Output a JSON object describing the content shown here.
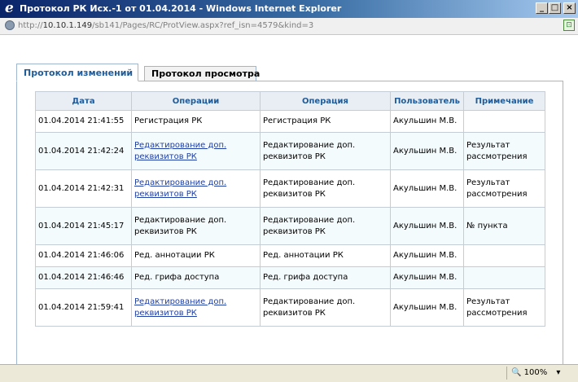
{
  "window": {
    "title": "Протокол РК Исх.-1 от 01.04.2014 - Windows Internet Explorer",
    "ie_logo_glyph": "e",
    "controls": {
      "minimize": "_",
      "maximize": "□",
      "close": "×"
    }
  },
  "address": {
    "prefix": "http://",
    "host": "10.10.1.149",
    "path": "/sb141/Pages/RC/ProtView.aspx?ref_isn=4579&kind=3"
  },
  "tabs": [
    {
      "label": "Протокол изменений",
      "active": true
    },
    {
      "label": "Протокол просмотра",
      "active": false
    }
  ],
  "table": {
    "headers": [
      "Дата",
      "Операции",
      "Операция",
      "Пользователь",
      "Примечание"
    ],
    "rows": [
      {
        "date": "01.04.2014 21:41:55",
        "ops": "Регистрация РК",
        "ops_link": false,
        "op": "Регистрация РК",
        "user": "Акульшин М.В.",
        "note": ""
      },
      {
        "date": "01.04.2014 21:42:24",
        "ops": "Редактирование доп. реквизитов РК",
        "ops_link": true,
        "op": "Редактирование доп. реквизитов РК",
        "user": "Акульшин М.В.",
        "note": "Результат рассмотрения"
      },
      {
        "date": "01.04.2014 21:42:31",
        "ops": "Редактирование доп. реквизитов РК",
        "ops_link": true,
        "op": "Редактирование доп. реквизитов РК",
        "user": "Акульшин М.В.",
        "note": "Результат рассмотрения"
      },
      {
        "date": "01.04.2014 21:45:17",
        "ops": "Редактирование доп. реквизитов РК",
        "ops_link": false,
        "op": "Редактирование доп. реквизитов РК",
        "user": "Акульшин М.В.",
        "note": "№ пункта"
      },
      {
        "date": "01.04.2014 21:46:06",
        "ops": "Ред. аннотации РК",
        "ops_link": false,
        "op": "Ред. аннотации РК",
        "user": "Акульшин М.В.",
        "note": ""
      },
      {
        "date": "01.04.2014 21:46:46",
        "ops": "Ред. грифа доступа",
        "ops_link": false,
        "op": "Ред. грифа доступа",
        "user": "Акульшин М.В.",
        "note": ""
      },
      {
        "date": "01.04.2014 21:59:41",
        "ops": "Редактирование доп. реквизитов РК",
        "ops_link": true,
        "op": "Редактирование доп. реквизитов РК",
        "user": "Акульшин М.В.",
        "note": "Результат рассмотрения"
      }
    ]
  },
  "status": {
    "zoom": "100%",
    "zoom_icon": "🔍",
    "zoom_dropdown": "▾"
  },
  "colors": {
    "header_text": "#1f5c99",
    "link": "#1f3fa6",
    "panel_border": "#9eb6ce"
  }
}
